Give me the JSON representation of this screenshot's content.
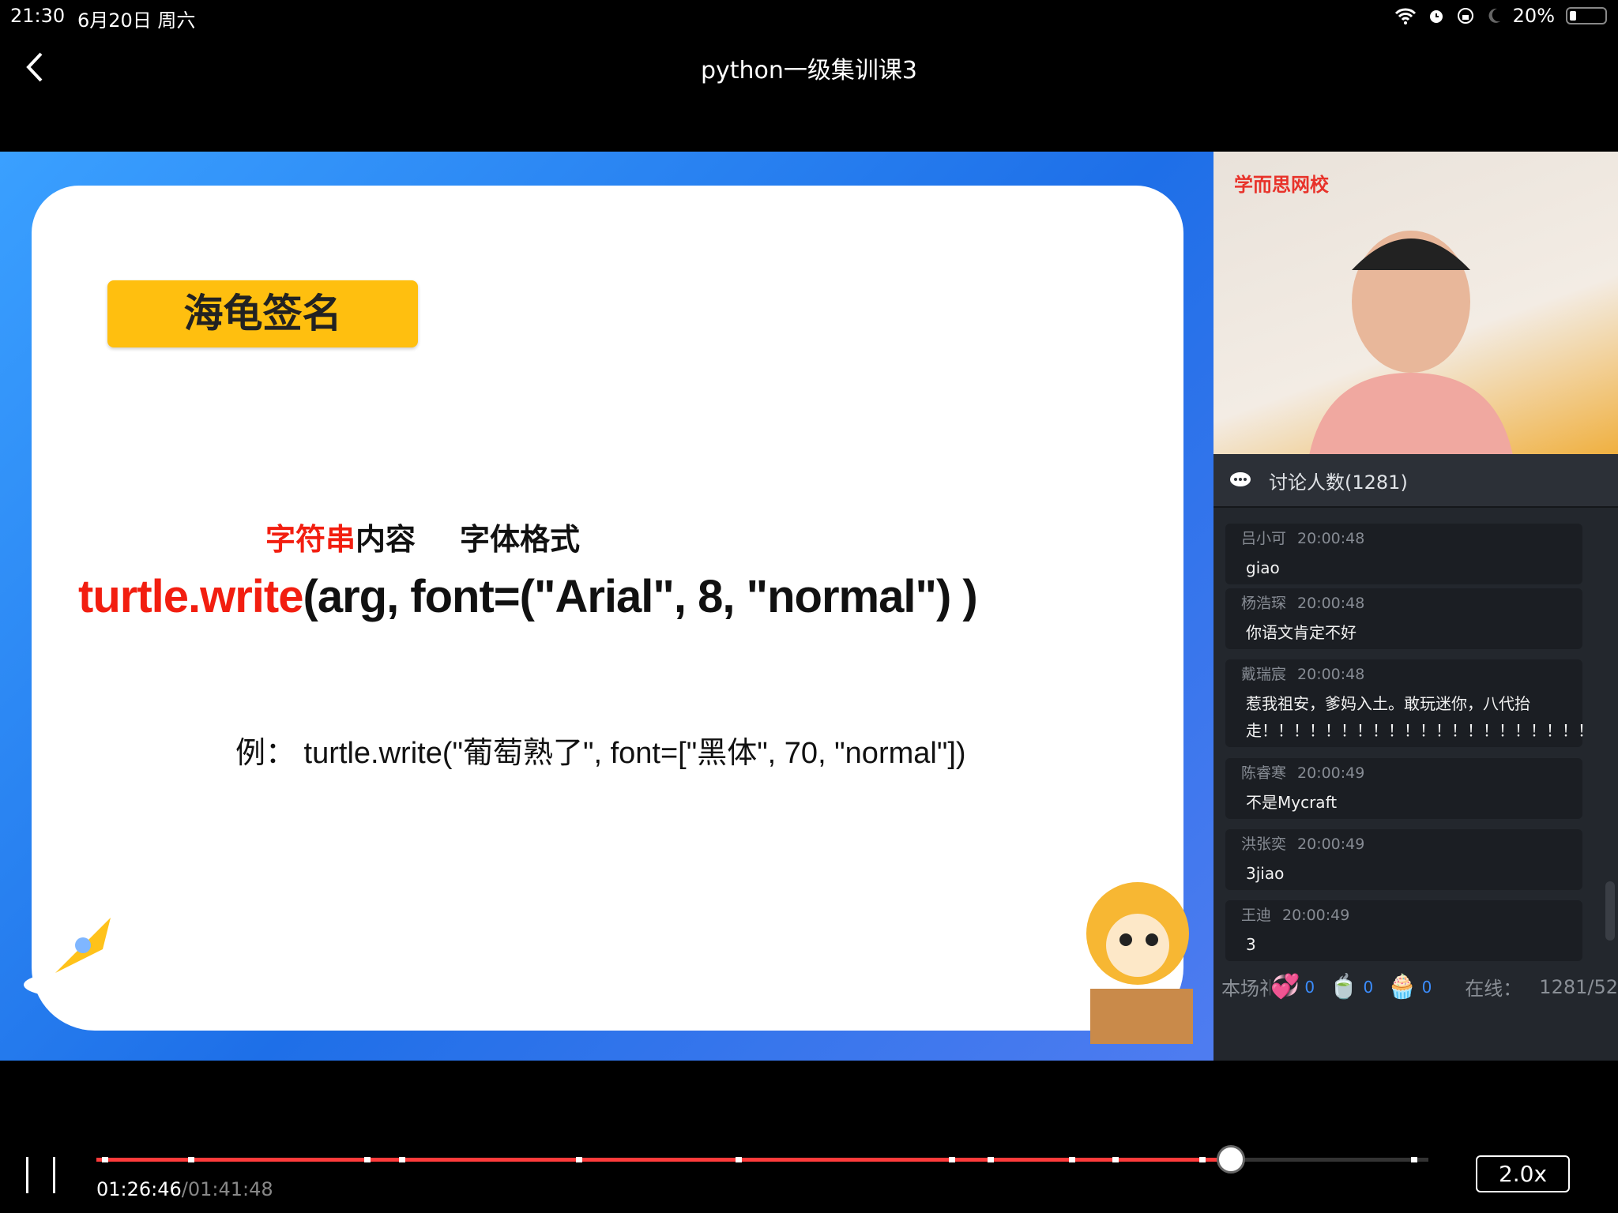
{
  "status_bar": {
    "time": "21:30",
    "date": "6月20日 周六",
    "battery": "20%",
    "icons": [
      "wifi-icon",
      "alarm-icon",
      "rotation-lock-icon",
      "moon-icon",
      "battery-icon"
    ]
  },
  "header": {
    "title": "python一级集训课3"
  },
  "slide": {
    "badge": "海龟签名",
    "label_red": "字符串",
    "label_black": "内容",
    "label_format": "字体格式",
    "code_red": "turtle.write",
    "code_black": "(arg, font=(\"Arial\", 8, \"normal\") )",
    "example": "例：  turtle.write(\"葡萄熟了\", font=[\"黑体\", 70, \"normal\"])"
  },
  "camera": {
    "logo": "学而思网校"
  },
  "chat": {
    "header": "讨论人数(1281)",
    "messages": [
      {
        "name": "吕小可",
        "time": "20:00:48",
        "text": "giao"
      },
      {
        "name": "杨浩琛",
        "time": "20:00:48",
        "text": "你语文肯定不好"
      },
      {
        "name": "戴瑞宸",
        "time": "20:00:48",
        "text": "惹我祖安，爹妈入土。敢玩迷你，八代抬走！！！！！！！！！！！！！！！！！！！！！"
      },
      {
        "name": "陈睿寒",
        "time": "20:00:49",
        "text": "不是Mycraft"
      },
      {
        "name": "洪张奕",
        "time": "20:00:49",
        "text": "3jiao"
      },
      {
        "name": "王迪",
        "time": "20:00:49",
        "text": "3"
      }
    ],
    "gifts_label": "本场礼物",
    "gifts": [
      {
        "icon": "heart-gift-icon",
        "count": "0"
      },
      {
        "icon": "cup-gift-icon",
        "count": "0"
      },
      {
        "icon": "cake-gift-icon",
        "count": "0"
      }
    ],
    "online_label": "在线：",
    "online_value": "1281/52"
  },
  "player": {
    "current": "01:26:46",
    "total": "/01:41:48",
    "progress": 0.852,
    "speed": "2.0x",
    "accent": "#ff3b3b"
  }
}
